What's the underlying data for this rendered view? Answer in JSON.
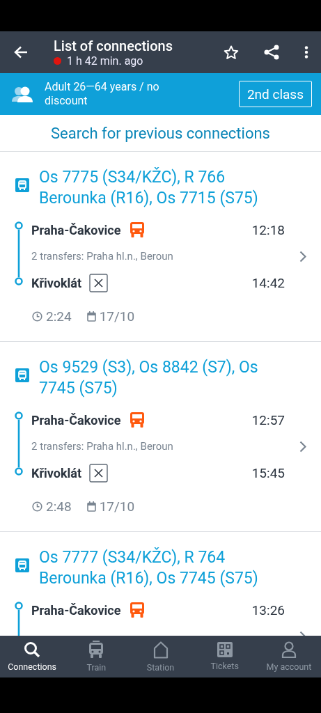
{
  "header": {
    "title": "List of connections",
    "subtitle": "1 h 42 min. ago"
  },
  "passenger": {
    "label": "Adult 26—64 years / no discount",
    "class_button": "2nd class"
  },
  "search_previous": "Search for previous connections",
  "connections": [
    {
      "trains": "Os 7775 (S34/KŽC), R 766 Berounka (R16), Os 7715 (S75)",
      "from": {
        "name": "Praha-Čakovice",
        "time": "12:18"
      },
      "transfers": "2 transfers: Praha hl.n., Beroun",
      "to": {
        "name": "Křivoklát",
        "time": "14:42"
      },
      "duration": "2:24",
      "date": "17/10"
    },
    {
      "trains": "Os 9529 (S3), Os 8842 (S7), Os 7745 (S75)",
      "from": {
        "name": "Praha-Čakovice",
        "time": "12:57"
      },
      "transfers": "2 transfers: Praha hl.n., Beroun",
      "to": {
        "name": "Křivoklát",
        "time": "15:45"
      },
      "duration": "2:48",
      "date": "17/10"
    },
    {
      "trains": "Os 7777 (S34/KŽC), R 764 Berounka (R16), Os 7745 (S75)",
      "from": {
        "name": "Praha-Čakovice",
        "time": "13:26"
      }
    }
  ],
  "nav": [
    {
      "kind": "search",
      "label": "Connections",
      "selected": true
    },
    {
      "kind": "train",
      "label": "Train",
      "selected": false
    },
    {
      "kind": "station",
      "label": "Station",
      "selected": false
    },
    {
      "kind": "tickets",
      "label": "Tickets",
      "selected": false
    },
    {
      "kind": "account",
      "label": "My account",
      "selected": false
    }
  ]
}
